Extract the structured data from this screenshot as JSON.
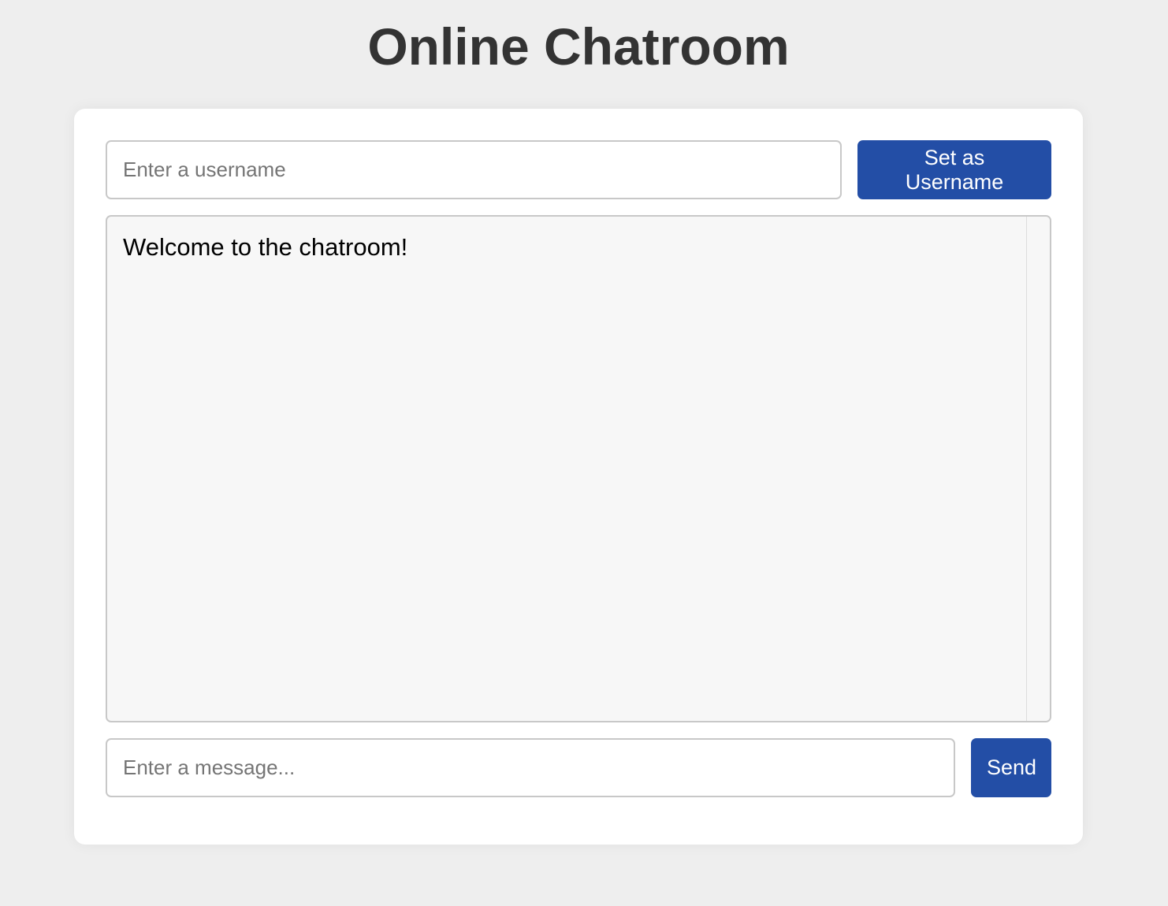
{
  "header": {
    "title": "Online Chatroom"
  },
  "username_form": {
    "placeholder": "Enter a username",
    "value": "",
    "button_label": "Set as Username"
  },
  "chat": {
    "messages": [
      {
        "text": "Welcome to the chatroom!"
      }
    ]
  },
  "message_form": {
    "placeholder": "Enter a message...",
    "value": "",
    "button_label": "Send"
  },
  "colors": {
    "page_background": "#eeeeee",
    "card_background": "#ffffff",
    "button_background": "#234ea6",
    "title_text": "#333333",
    "chat_background": "#f7f7f7"
  }
}
